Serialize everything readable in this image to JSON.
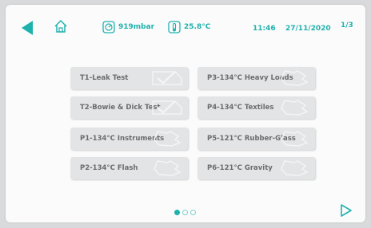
{
  "status": {
    "pressure": "919mbar",
    "temperature": "25.8°C",
    "time": "11:46",
    "date": "27/11/2020",
    "page": "1/3",
    "icons": [
      "back-arrow-icon",
      "home-icon",
      "pressure-gauge-icon",
      "thermometer-icon"
    ]
  },
  "programs": {
    "left": [
      {
        "label": "T1-Leak Test",
        "icon": "checkmark-icon"
      },
      {
        "label": "T2-Bowie & Dick Test",
        "icon": "checkmark-icon"
      },
      {
        "label": "P1-134°C Instruments",
        "icon": "wrap-icon"
      },
      {
        "label": "P2-134°C Flash",
        "icon": "wrap-icon"
      }
    ],
    "right": [
      {
        "label": "P3-134°C Heavy Loads",
        "icon": "wrap-icon"
      },
      {
        "label": "P4-134°C Textiles",
        "icon": "wrap-icon"
      },
      {
        "label": "P5-121°C Rubber-Glass",
        "icon": "wrap-icon"
      },
      {
        "label": "P6-121°C  Gravity",
        "icon": "wrap-icon"
      }
    ]
  },
  "pager": {
    "current": 1,
    "total": 3
  },
  "colors": {
    "accent": "#1fb2ad",
    "button": "#e3e4e5",
    "label": "#6a6c6e"
  }
}
